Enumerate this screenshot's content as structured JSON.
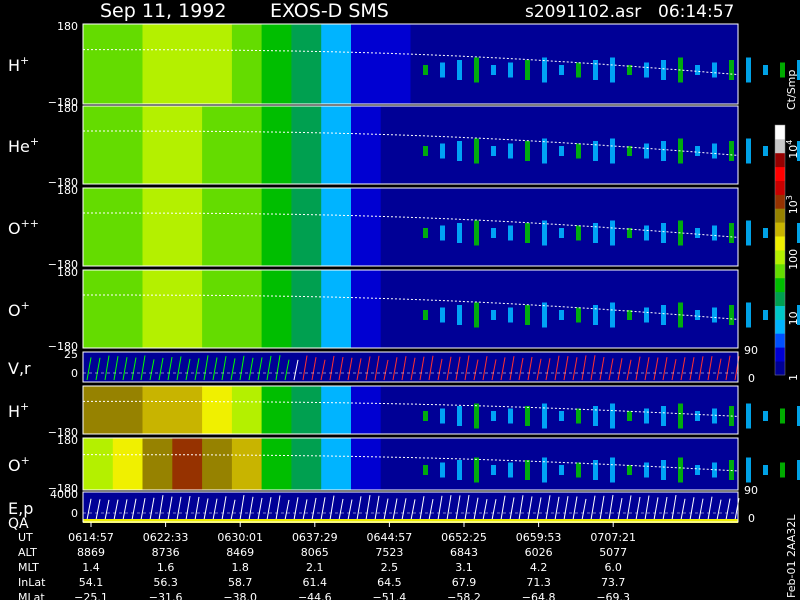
{
  "header": {
    "date": "Sep 11, 1992",
    "instrument": "EXOS-D SMS",
    "file": "s2091102.asr",
    "time": "06:14:57"
  },
  "colorbar": {
    "unit": "Ct/Smp",
    "ticks": [
      {
        "label": "1",
        "value": 1
      },
      {
        "label": "10",
        "value": 10
      },
      {
        "label": "100",
        "value": 100
      },
      {
        "label": "10",
        "sup": "3",
        "value": 1000
      },
      {
        "label": "10",
        "sup": "4",
        "value": 10000
      }
    ],
    "colors": [
      "#000096",
      "#0000d2",
      "#0050ff",
      "#00b4ff",
      "#00c8c8",
      "#00a050",
      "#00be00",
      "#64dc00",
      "#b4f000",
      "#f0f000",
      "#c8b400",
      "#968200",
      "#963200",
      "#c80000",
      "#ff0000",
      "#960000",
      "#c8c8c8",
      "#ffffff"
    ]
  },
  "chart_data": {
    "type": "heatmap",
    "title": "Sep 11, 1992  EXOS-D SMS",
    "x_axis": {
      "quantity": "UT",
      "ticks": [
        "0614:57",
        "0622:33",
        "0630:01",
        "0637:29",
        "0644:57",
        "0652:25",
        "0659:53",
        "0707:21"
      ]
    },
    "panels": [
      {
        "key": "hp",
        "label": "H",
        "sup": "+",
        "ymax": "180",
        "ymin": "−180",
        "kind": "spectrogram",
        "band_values": [
          60,
          70,
          130,
          120,
          80,
          60,
          35,
          20,
          6,
          2,
          1.5,
          1.2,
          1,
          1,
          1,
          1,
          1,
          1,
          1,
          1,
          1,
          1
        ]
      },
      {
        "key": "hep",
        "label": "He",
        "sup": "+",
        "ymax": "180",
        "ymin": "−180",
        "kind": "spectrogram",
        "band_values": [
          50,
          60,
          100,
          95,
          70,
          50,
          30,
          18,
          5,
          1.5,
          1.2,
          1,
          1,
          1,
          1,
          1,
          1,
          1,
          1,
          1,
          1,
          1
        ]
      },
      {
        "key": "opp",
        "label": "O",
        "sup": "++",
        "ymax": "180",
        "ymin": "−180",
        "kind": "spectrogram",
        "band_values": [
          50,
          60,
          100,
          95,
          70,
          50,
          30,
          18,
          5,
          1.5,
          1.2,
          1,
          1,
          1,
          1,
          1,
          1,
          1,
          1,
          1,
          1,
          1
        ]
      },
      {
        "key": "op",
        "label": "O",
        "sup": "+",
        "ymax": "180",
        "ymin": "−180",
        "kind": "spectrogram",
        "band_values": [
          50,
          55,
          95,
          90,
          70,
          50,
          30,
          18,
          5,
          1.5,
          1.2,
          1,
          1,
          1,
          1,
          1,
          1,
          1,
          1,
          1,
          1,
          1
        ]
      },
      {
        "key": "vr",
        "label": "V,r",
        "ymax": "25",
        "ymid": "0",
        "right_top": "90",
        "right_bottom": "0",
        "kind": "line"
      },
      {
        "key": "hp2",
        "label": "H",
        "sup": "+",
        "ymin": "−180",
        "kind": "spectrogram",
        "band_values": [
          500,
          450,
          400,
          300,
          200,
          80,
          30,
          18,
          5,
          1.5,
          1.2,
          1,
          1,
          1,
          1,
          1,
          1,
          1,
          1,
          1,
          1,
          1
        ]
      },
      {
        "key": "op2",
        "label": "O",
        "sup": "+",
        "ymax": "180",
        "ymin": "−180",
        "kind": "spectrogram",
        "band_values": [
          80,
          150,
          600,
          800,
          500,
          250,
          40,
          20,
          5,
          1.5,
          1.2,
          1,
          1,
          1,
          1,
          1,
          1,
          1,
          1,
          1,
          1,
          1
        ]
      },
      {
        "key": "ep",
        "label": "E,p",
        "label2": "QA",
        "ymax": "4000",
        "ymid": "0",
        "right_top": "90",
        "right_bottom": "0",
        "kind": "line"
      }
    ]
  },
  "orbit": {
    "rows": [
      {
        "label": "UT",
        "values": [
          "0614:57",
          "0622:33",
          "0630:01",
          "0637:29",
          "0644:57",
          "0652:25",
          "0659:53",
          "0707:21"
        ]
      },
      {
        "label": "ALT",
        "values": [
          "8869",
          "8736",
          "8469",
          "8065",
          "7523",
          "6843",
          "6026",
          "5077"
        ]
      },
      {
        "label": "MLT",
        "values": [
          "1.4",
          "1.6",
          "1.8",
          "2.1",
          "2.5",
          "3.1",
          "4.2",
          "6.0"
        ]
      },
      {
        "label": "InLat",
        "values": [
          "54.1",
          "56.3",
          "58.7",
          "61.4",
          "64.5",
          "67.9",
          "71.3",
          "73.7"
        ]
      },
      {
        "label": "MLat",
        "values": [
          "−25.1",
          "−31.6",
          "−38.0",
          "−44.6",
          "−51.4",
          "−58.2",
          "−64.8",
          "−69.3"
        ]
      }
    ]
  },
  "footer": {
    "side_text": "Feb-01 2AA32L"
  }
}
